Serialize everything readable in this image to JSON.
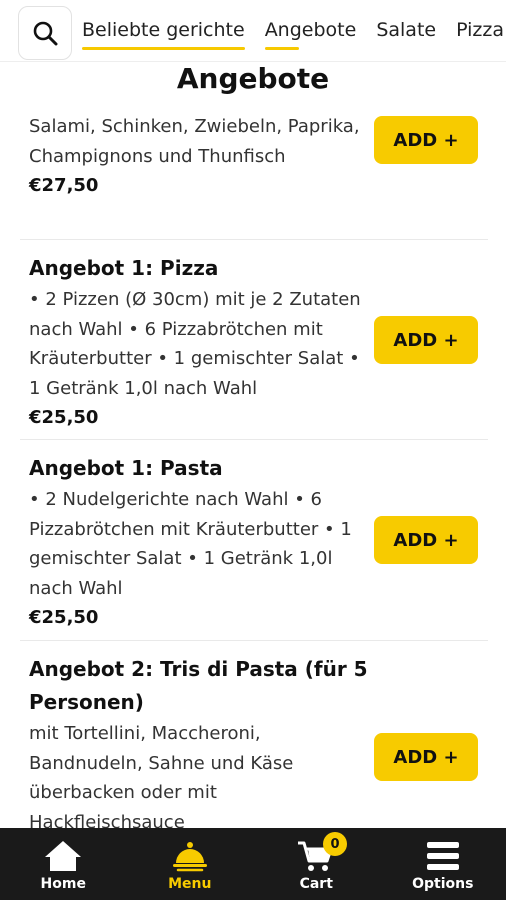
{
  "header": {
    "search_icon": "search-icon",
    "tabs": [
      "Beliebte gerichte",
      "Angebote",
      "Salate",
      "Pizza"
    ]
  },
  "section_title": "Angebote",
  "items": [
    {
      "title": "",
      "desc": "Salami, Schinken, Zwiebeln, Paprika, Champignons und Thunfisch",
      "price": "€27,50",
      "add_label": "ADD +"
    },
    {
      "title": "Angebot 1: Pizza",
      "desc": "• 2 Pizzen (Ø 30cm) mit je 2 Zutaten nach Wahl • 6 Pizzabrötchen mit Kräuterbutter • 1 gemischter Salat • 1 Getränk 1,0l nach Wahl",
      "price": "€25,50",
      "add_label": "ADD +"
    },
    {
      "title": "Angebot 1: Pasta",
      "desc": "• 2 Nudelgerichte nach Wahl • 6 Pizzabrötchen mit Kräuterbutter • 1 gemischter Salat • 1 Getränk 1,0l nach Wahl",
      "price": "€25,50",
      "add_label": "ADD +"
    },
    {
      "title": "Angebot 2: Tris di Pasta (für 5 Personen)",
      "desc": "mit Tortellini, Maccheroni, Bandnudeln, Sahne und Käse überbacken oder mit Hackfleischsauce",
      "price": "",
      "add_label": "ADD +"
    }
  ],
  "nav": {
    "home": "Home",
    "menu": "Menu",
    "cart": "Cart",
    "cart_count": "0",
    "options": "Options"
  },
  "colors": {
    "accent": "#f7cb00",
    "nav_bg": "#1a1a1a"
  }
}
